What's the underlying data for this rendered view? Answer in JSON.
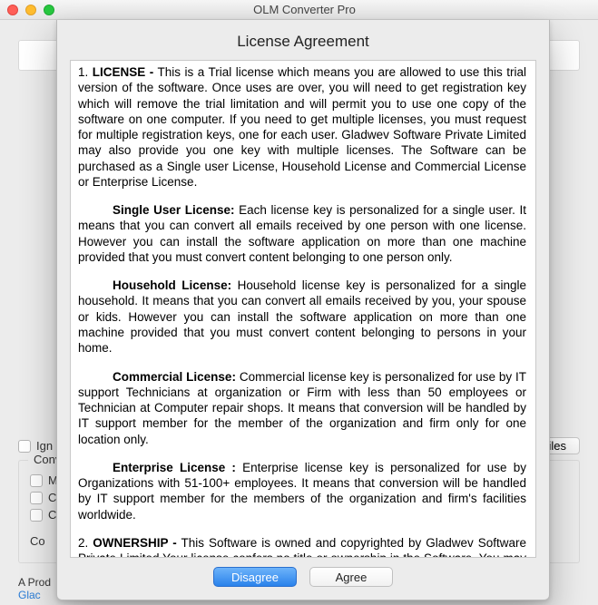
{
  "window": {
    "title": "OLM Converter Pro"
  },
  "sheet": {
    "title": "License Agreement",
    "buttons": {
      "disagree": "Disagree",
      "agree": "Agree"
    }
  },
  "license": {
    "sec1_num": "1.",
    "sec1_head": "LICENSE -",
    "sec1_body": " This is a Trial license which means you are allowed to use this trial version of the software. Once uses are over, you will need to get registration key which will remove the trial limitation and will permit you to use one copy of the software on one computer. If you need to get multiple licenses, you must request for multiple registration keys, one for each user. Gladwev Software Private Limited may also provide you one key with multiple licenses. The Software can be purchased as a Single user License, Household License and Commercial License or Enterprise License.",
    "single_head": "Single User License:",
    "single_body": " Each license key is personalized for a single user. It means that you can convert all emails received by one person with one license. However you can install the software application on more than one machine provided that you must convert content belonging to one person only.",
    "household_head": "Household License:",
    "household_body": " Household license key is personalized for a single household. It means that you can convert all emails received by you, your spouse or kids. However you can install the software application on more than one machine provided that you must convert content belonging to persons in your home.",
    "commercial_head": "Commercial License:",
    "commercial_body": " Commercial license key is personalized for use by IT support Technicians at organization or Firm with less than 50 employees or Technician at Computer repair shops. It means that conversion will be handled by IT support member for the member of the organization and firm only for one location only.",
    "enterprise_head": "Enterprise License :",
    "enterprise_body": " Enterprise license key is personalized for use by Organizations with 51-100+ employees. It means that conversion will be handled by IT support member for the members of the organization and firm's facilities worldwide.",
    "sec2_num": "2.",
    "sec2_head": "OWNERSHIP -",
    "sec2_body": " This Software is owned and copyrighted by Gladwev Software Private Limited Your license confers no title or ownership in the Software. You may make a copy of this software solely for back up purposes. Licensee shall not"
  },
  "bg": {
    "ignore": "Ign",
    "files_btn": "iles",
    "convert_group": "Conv",
    "opt_m": "M",
    "opt_c1": "C",
    "opt_c2": "C",
    "co_label": "Co",
    "prod": "A Prod",
    "brand": "Glac"
  }
}
